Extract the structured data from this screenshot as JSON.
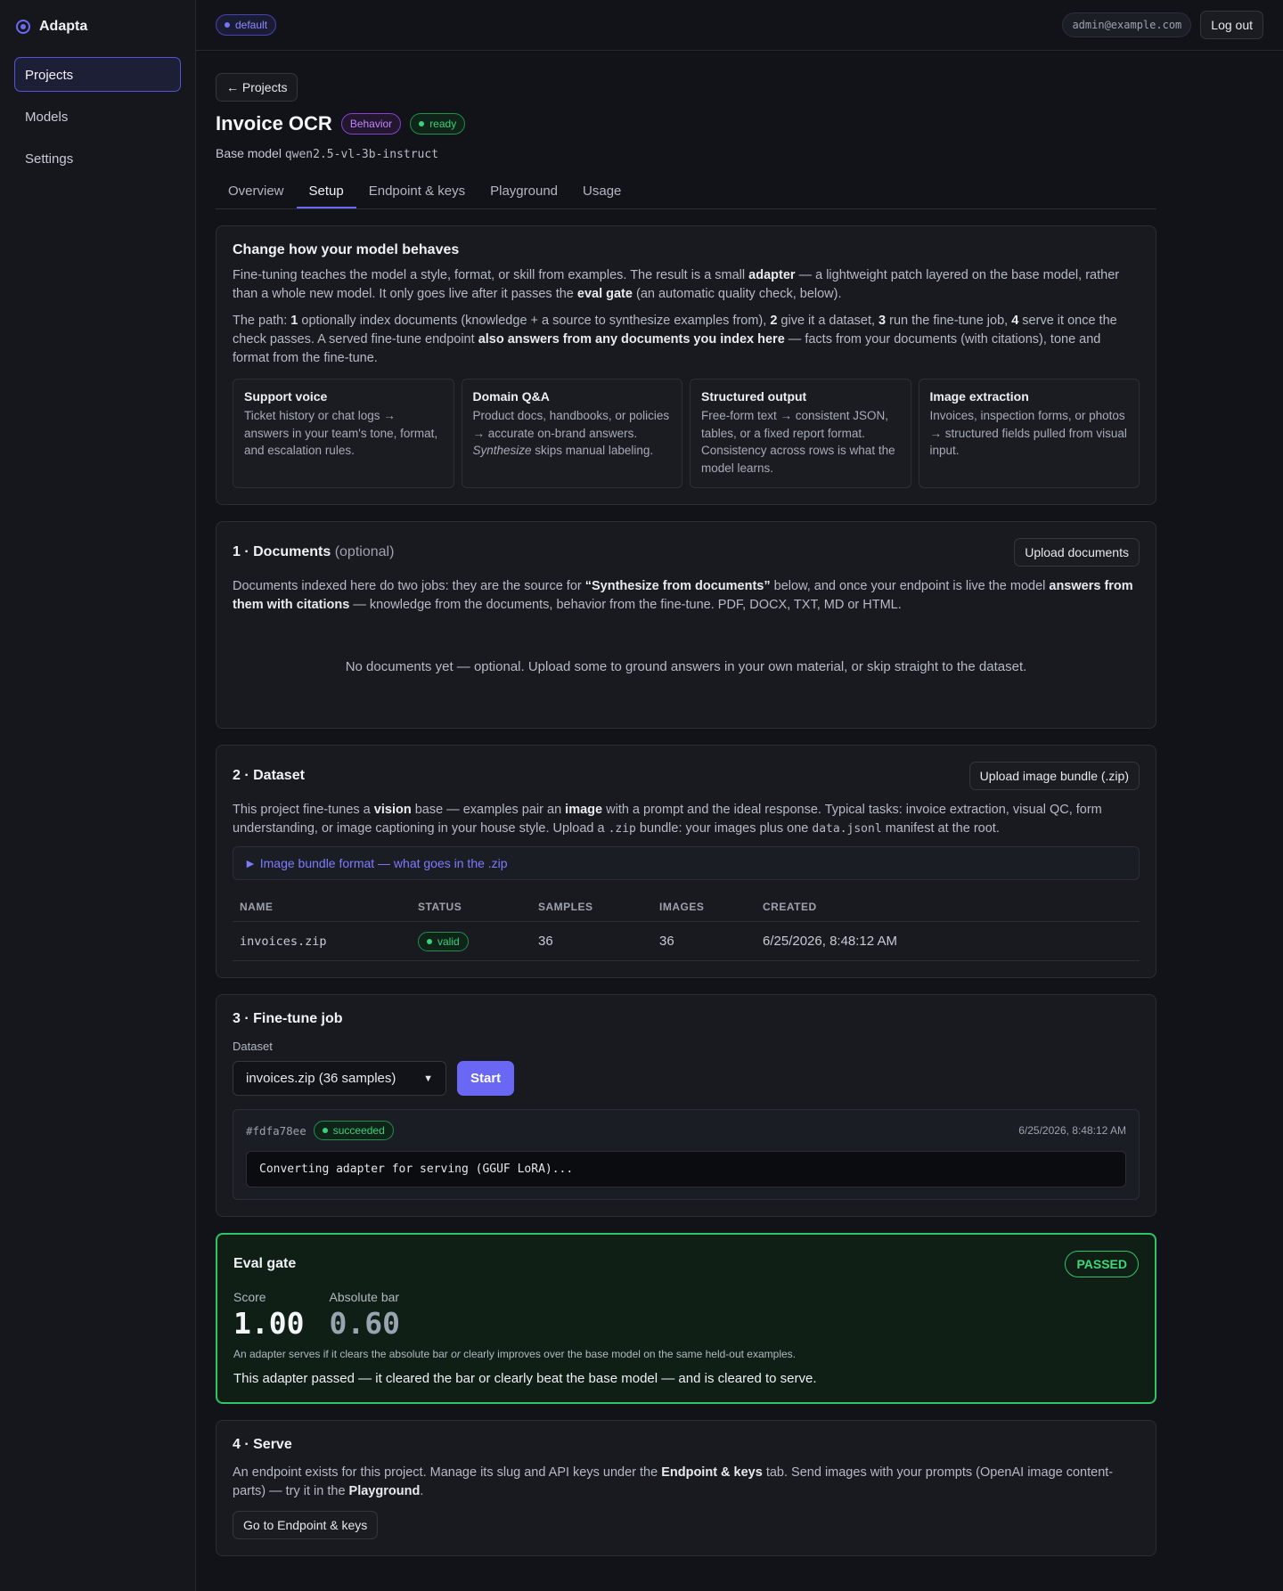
{
  "sidebar": {
    "brand": "Adapta",
    "items": [
      {
        "label": "Projects"
      },
      {
        "label": "Models"
      },
      {
        "label": "Settings"
      }
    ]
  },
  "topbar": {
    "workspace": "default",
    "email": "admin@example.com",
    "logout": "Log out"
  },
  "project": {
    "back": "← Projects",
    "title": "Invoice OCR",
    "type_badge": "Behavior",
    "status_badge": "ready",
    "base_model_label": "Base model",
    "base_model": "qwen2.5-vl-3b-instruct",
    "tabs": [
      "Overview",
      "Setup",
      "Endpoint & keys",
      "Playground",
      "Usage"
    ],
    "active_tab": "Setup"
  },
  "intro": {
    "heading": "Change how your model behaves",
    "p1_a": "Fine-tuning teaches the model a style, format, or skill from examples. The result is a small ",
    "p1_b": "adapter",
    "p1_c": " — a lightweight patch layered on the base model, rather than a whole new model. It only goes live after it passes the ",
    "p1_d": "eval gate",
    "p1_e": " (an automatic quality check, below).",
    "p2_a": "The path: ",
    "p2_n1": "1",
    "p2_b": " optionally index documents (knowledge + a source to synthesize examples from), ",
    "p2_n2": "2",
    "p2_c": " give it a dataset, ",
    "p2_n3": "3",
    "p2_d": " run the fine-tune job, ",
    "p2_n4": "4",
    "p2_e": " serve it once the check passes. A served fine-tune endpoint ",
    "p2_f": "also answers from any documents you index here",
    "p2_g": " — facts from your documents (with citations), tone and format from the fine-tune.",
    "use_cases": [
      {
        "title": "Support voice",
        "text": "Ticket history or chat logs → answers in your team's tone, format, and escalation rules."
      },
      {
        "title": "Domain Q&A",
        "text_a": "Product docs, handbooks, or policies → accurate on-brand answers. ",
        "text_em": "Synthesize",
        "text_b": " skips manual labeling."
      },
      {
        "title": "Structured output",
        "text": "Free-form text → consistent JSON, tables, or a fixed report format. Consistency across rows is what the model learns."
      },
      {
        "title": "Image extraction",
        "text": "Invoices, inspection forms, or photos → structured fields pulled from visual input."
      }
    ]
  },
  "documents": {
    "heading": "1 · Documents",
    "optional": "(optional)",
    "upload": "Upload documents",
    "p_a": "Documents indexed here do two jobs: they are the source for ",
    "p_b": "“Synthesize from documents”",
    "p_c": " below, and once your endpoint is live the model ",
    "p_d": "answers from them with citations",
    "p_e": " — knowledge from the documents, behavior from the fine-tune. PDF, DOCX, TXT, MD or HTML.",
    "empty": "No documents yet — optional. Upload some to ground answers in your own material, or skip straight to the dataset."
  },
  "dataset": {
    "heading": "2 · Dataset",
    "upload": "Upload image bundle (.zip)",
    "p_a": "This project fine-tunes a ",
    "p_b": "vision",
    "p_c": " base — examples pair an ",
    "p_d": "image",
    "p_e": " with a prompt and the ideal response. Typical tasks: invoice extraction, visual QC, form understanding, or image captioning in your house style. Upload a ",
    "p_code1": ".zip",
    "p_f": " bundle: your images plus one ",
    "p_code2": "data.jsonl",
    "p_g": " manifest at the root.",
    "details": "► Image bundle format — what goes in the .zip",
    "columns": [
      "NAME",
      "STATUS",
      "SAMPLES",
      "IMAGES",
      "CREATED"
    ],
    "rows": [
      {
        "name": "invoices.zip",
        "status": "valid",
        "samples": "36",
        "images": "36",
        "created": "6/25/2026, 8:48:12 AM"
      }
    ]
  },
  "finetune": {
    "heading": "3 · Fine-tune job",
    "dataset_label": "Dataset",
    "selected": "invoices.zip (36 samples)",
    "start": "Start",
    "job": {
      "id": "#fdfa78ee",
      "status": "succeeded",
      "time": "6/25/2026, 8:48:12 AM",
      "log": "Converting adapter for serving (GGUF LoRA)..."
    }
  },
  "eval": {
    "heading": "Eval gate",
    "badge": "PASSED",
    "score_label": "Score",
    "score": "1.00",
    "bar_label": "Absolute bar",
    "bar": "0.60",
    "note_a": "An adapter serves if it clears the absolute bar ",
    "note_em": "or",
    "note_b": " clearly improves over the base model on the same held-out examples.",
    "message": "This adapter passed — it cleared the bar or clearly beat the base model — and is cleared to serve."
  },
  "serve": {
    "heading": "4 · Serve",
    "p_a": "An endpoint exists for this project. Manage its slug and API keys under the ",
    "p_b": "Endpoint & keys",
    "p_c": " tab. Send images with your prompts (OpenAI image content-parts) — try it in the ",
    "p_d": "Playground",
    "p_e": ".",
    "button": "Go to Endpoint & keys"
  }
}
